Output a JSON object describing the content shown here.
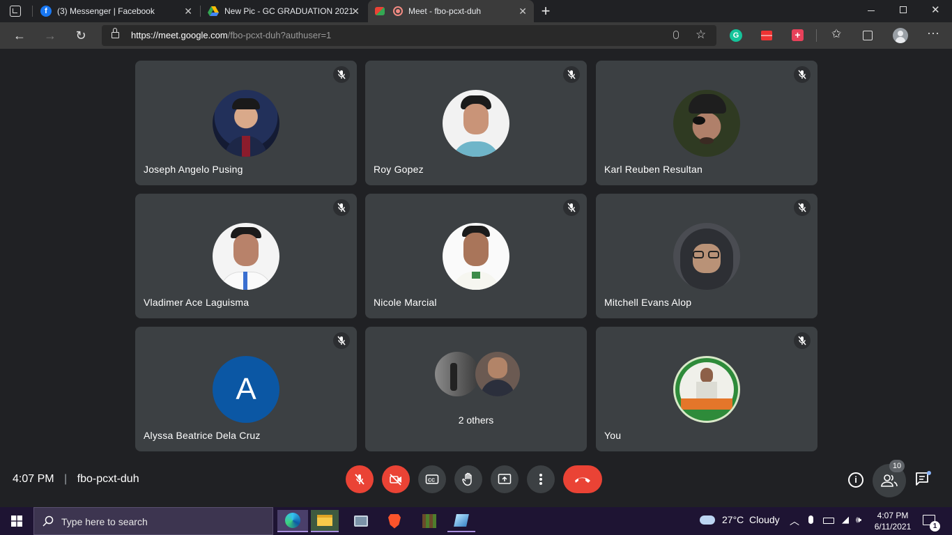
{
  "browser": {
    "tabs": [
      {
        "title": "(3) Messenger | Facebook",
        "icon": "facebook-icon"
      },
      {
        "title": "New Pic - GC GRADUATION 2021",
        "icon": "google-drive-icon"
      },
      {
        "title": "Meet - fbo-pcxt-duh",
        "icon": "google-meet-icon"
      }
    ],
    "new_tab": "+",
    "address": {
      "host": "https://meet.google.com",
      "path": "/fbo-pcxt-duh?authuser=1"
    }
  },
  "participants": [
    {
      "name": "Joseph Angelo Pusing",
      "muted": true
    },
    {
      "name": "Roy Gopez",
      "muted": true
    },
    {
      "name": "Karl Reuben Resultan",
      "muted": true
    },
    {
      "name": "Vladimer Ace Laguisma",
      "muted": true
    },
    {
      "name": "Nicole Marcial",
      "muted": true
    },
    {
      "name": "Mitchell Evans Alop",
      "muted": true
    },
    {
      "name": "Alyssa Beatrice Dela Cruz",
      "muted": true,
      "initial": "A"
    },
    {
      "name": "2 others"
    },
    {
      "name": "You",
      "muted": true
    }
  ],
  "meeting": {
    "time": "4:07 PM",
    "divider": "|",
    "code": "fbo-pcxt-duh",
    "people_count": "10"
  },
  "colors": {
    "end_call": "#ea4335",
    "avatar_a": "#0b57a4",
    "tile": "#3c4043"
  },
  "taskbar": {
    "search_placeholder": "Type here to search",
    "weather": "27°C  Cloudy",
    "clock_time": "4:07 PM",
    "clock_date": "6/11/2021",
    "notification_count": "1"
  }
}
